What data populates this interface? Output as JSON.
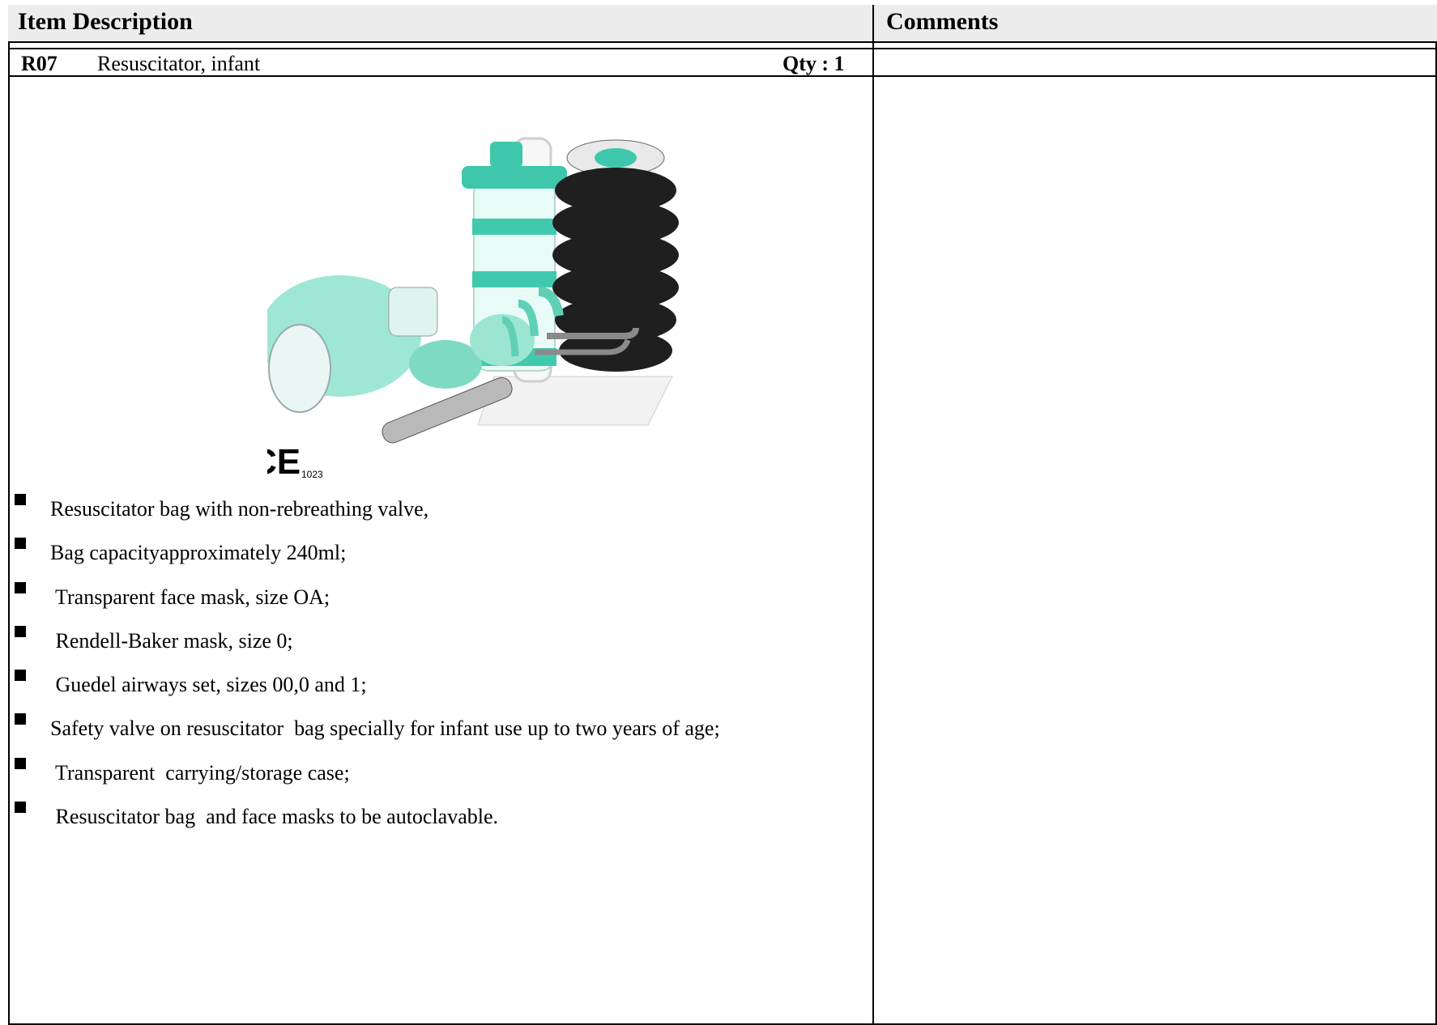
{
  "table": {
    "header": {
      "item_description": "Item Description",
      "comments": "Comments"
    },
    "item": {
      "code": "R07",
      "name": "Resuscitator, infant",
      "qty": "Qty : 1"
    },
    "product_image": {
      "mark": "CE",
      "notified_body": "1023"
    },
    "specifications": [
      "Resuscitator bag with non-rebreathing valve,",
      "Bag capacityapproximately 240ml;",
      " Transparent face mask, size OA;",
      " Rendell-Baker mask, size 0;",
      " Guedel airways set, sizes 00,0 and 1;",
      "Safety valve on resuscitator  bag specially for infant use up to two years of age;",
      " Transparent  carrying/storage case;",
      " Resuscitator bag  and face masks to be autoclavable."
    ]
  }
}
